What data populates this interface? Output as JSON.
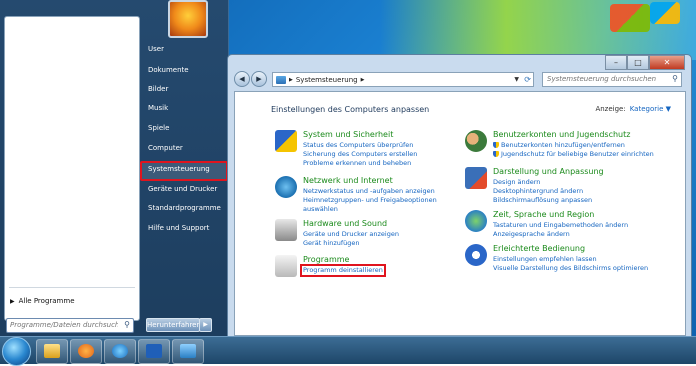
{
  "start_menu": {
    "all_programs": "Alle Programme",
    "search_placeholder": "Programme/Dateien durchsuchen",
    "right_items": [
      "User",
      "Dokumente",
      "Bilder",
      "Musik",
      "Spiele",
      "Computer",
      "Systemsteuerung",
      "Geräte und Drucker",
      "Standardprogramme",
      "Hilfe und Support"
    ],
    "shutdown_label": "Herunterfahren",
    "shutdown_arrow": "▶"
  },
  "window": {
    "breadcrumb": "Systemsteuerung",
    "breadcrumb_sep": "▶",
    "search_placeholder": "Systemsteuerung durchsuchen",
    "heading": "Einstellungen des Computers anpassen",
    "view_label": "Anzeige:",
    "view_value": "Kategorie ▼"
  },
  "categories_left": [
    {
      "title": "System und Sicherheit",
      "links": [
        "Status des Computers überprüfen",
        "Sicherung des Computers erstellen",
        "Probleme erkennen und beheben"
      ]
    },
    {
      "title": "Netzwerk und Internet",
      "links": [
        "Netzwerkstatus und -aufgaben anzeigen",
        "Heimnetzgruppen- und Freigabeoptionen",
        "auswählen"
      ]
    },
    {
      "title": "Hardware und Sound",
      "links": [
        "Geräte und Drucker anzeigen",
        "Gerät hinzufügen"
      ]
    },
    {
      "title": "Programme",
      "links": [
        "Programm deinstallieren"
      ]
    }
  ],
  "categories_right": [
    {
      "title": "Benutzerkonten und Jugendschutz",
      "links": [
        "Benutzerkonten hinzufügen/entfernen",
        "Jugendschutz für beliebige Benutzer einrichten"
      ]
    },
    {
      "title": "Darstellung und Anpassung",
      "links": [
        "Design ändern",
        "Desktophintergrund ändern",
        "Bildschirmauflösung anpassen"
      ]
    },
    {
      "title": "Zeit, Sprache und Region",
      "links": [
        "Tastaturen und Eingabemethoden ändern",
        "Anzeigesprache ändern"
      ]
    },
    {
      "title": "Erleichterte Bedienung",
      "links": [
        "Einstellungen empfehlen lassen",
        "Visuelle Darstellung des Bildschirms optimieren"
      ]
    }
  ],
  "colors": {
    "highlight": "#e0141e",
    "category_green": "#1b8a1b",
    "link_blue": "#1565c0"
  }
}
